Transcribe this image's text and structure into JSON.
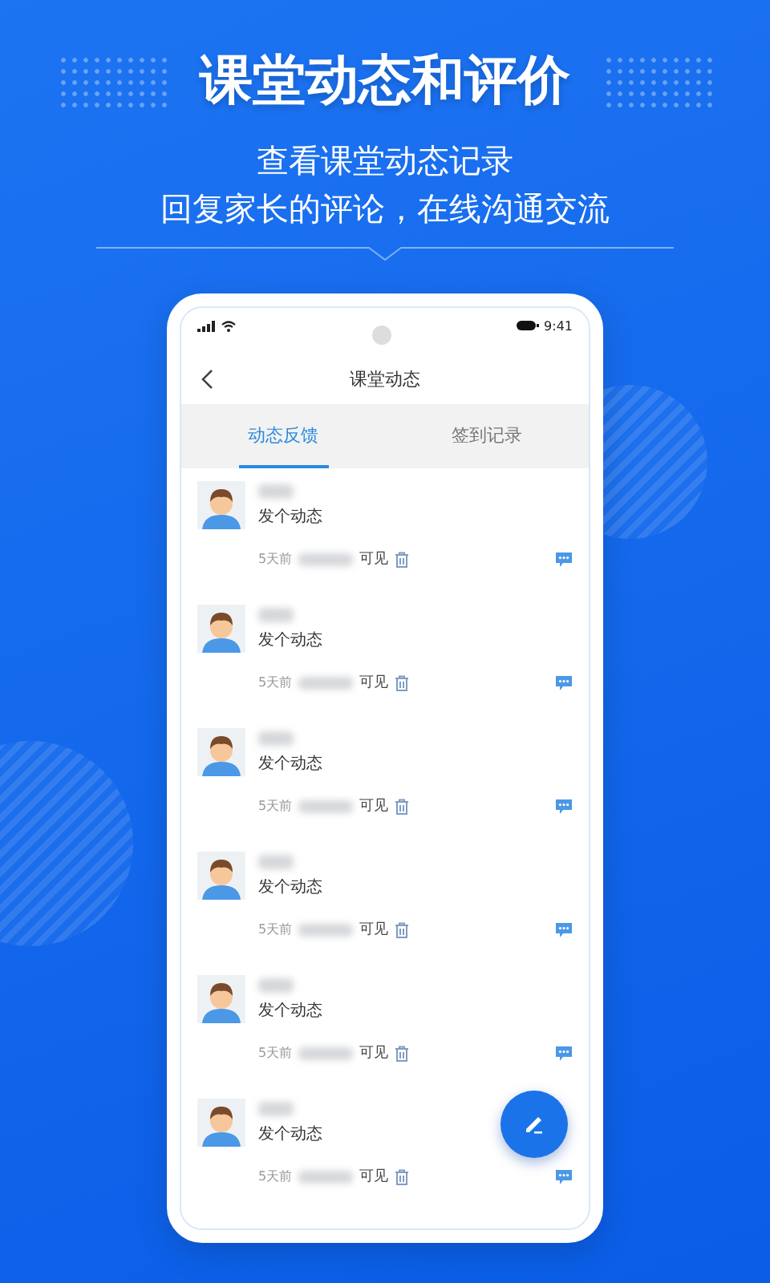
{
  "headline": "课堂动态和评价",
  "subtitle_lines": [
    "查看课堂动态记录",
    "回复家长的评论，在线沟通交流"
  ],
  "status_bar": {
    "time": "9:41"
  },
  "nav": {
    "title": "课堂动态"
  },
  "tabs": [
    {
      "label": "动态反馈",
      "selected": true
    },
    {
      "label": "签到记录",
      "selected": false
    }
  ],
  "posts": [
    {
      "text": "发个动态",
      "time": "5天前",
      "visibility": "可见"
    },
    {
      "text": "发个动态",
      "time": "5天前",
      "visibility": "可见"
    },
    {
      "text": "发个动态",
      "time": "5天前",
      "visibility": "可见"
    },
    {
      "text": "发个动态",
      "time": "5天前",
      "visibility": "可见"
    },
    {
      "text": "发个动态",
      "time": "5天前",
      "visibility": "可见"
    },
    {
      "text": "发个动态",
      "time": "5天前",
      "visibility": "可见"
    }
  ]
}
